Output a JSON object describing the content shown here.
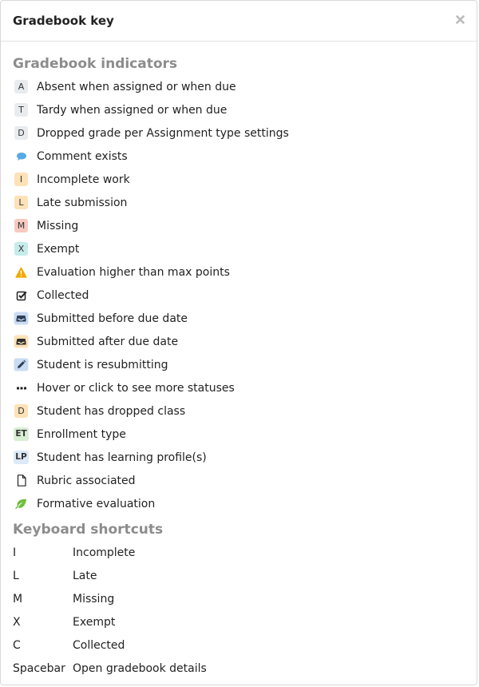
{
  "modal": {
    "title": "Gradebook key"
  },
  "indicators": {
    "title": "Gradebook indicators",
    "items": [
      {
        "icon": "badge",
        "badge": "A",
        "color": "gray",
        "label": "Absent when assigned or when due"
      },
      {
        "icon": "badge",
        "badge": "T",
        "color": "gray",
        "label": "Tardy when assigned or when due"
      },
      {
        "icon": "badge",
        "badge": "D",
        "color": "gray",
        "label": "Dropped grade per Assignment type settings"
      },
      {
        "icon": "comment-icon",
        "label": "Comment exists"
      },
      {
        "icon": "badge",
        "badge": "I",
        "color": "orange",
        "label": "Incomplete work"
      },
      {
        "icon": "badge",
        "badge": "L",
        "color": "orange",
        "label": "Late submission"
      },
      {
        "icon": "badge",
        "badge": "M",
        "color": "red",
        "label": "Missing"
      },
      {
        "icon": "badge",
        "badge": "X",
        "color": "teal",
        "label": "Exempt"
      },
      {
        "icon": "warning-icon",
        "label": "Evaluation higher than max points"
      },
      {
        "icon": "checkbox-icon",
        "label": "Collected"
      },
      {
        "icon": "inbox-blue-icon",
        "label": "Submitted before due date"
      },
      {
        "icon": "inbox-orange-icon",
        "label": "Submitted after due date"
      },
      {
        "icon": "pencil-icon",
        "label": "Student is resubmitting"
      },
      {
        "icon": "ellipsis-icon",
        "label": "Hover or click to see more statuses"
      },
      {
        "icon": "badge",
        "badge": "D",
        "color": "orange",
        "label": "Student has dropped class"
      },
      {
        "icon": "badge",
        "badge": "ET",
        "color": "green",
        "label": "Enrollment type"
      },
      {
        "icon": "badge",
        "badge": "LP",
        "color": "blue",
        "label": "Student has learning profile(s)"
      },
      {
        "icon": "document-icon",
        "label": "Rubric associated"
      },
      {
        "icon": "leaf-icon",
        "label": "Formative evaluation"
      }
    ]
  },
  "shortcuts": {
    "title": "Keyboard shortcuts",
    "items": [
      {
        "key": "I",
        "desc": "Incomplete"
      },
      {
        "key": "L",
        "desc": "Late"
      },
      {
        "key": "M",
        "desc": "Missing"
      },
      {
        "key": "X",
        "desc": "Exempt"
      },
      {
        "key": "C",
        "desc": "Collected"
      },
      {
        "key": "Spacebar",
        "desc": "Open gradebook details"
      }
    ]
  }
}
